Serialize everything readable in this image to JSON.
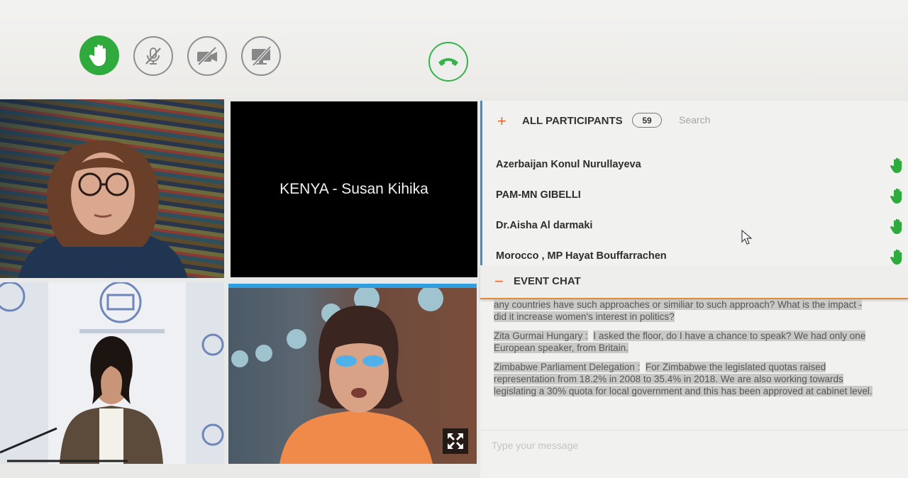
{
  "toolbar": {
    "icons": [
      "raise-hand-icon",
      "mic-muted-icon",
      "camera-off-icon",
      "screen-share-off-icon",
      "hang-up-icon"
    ],
    "colors": {
      "hand": "#2eab3c",
      "hangup": "#36b34a"
    }
  },
  "videos": {
    "kenya_label": "KENYA - Susan Kihika"
  },
  "participants": {
    "title": "ALL PARTICIPANTS",
    "count": "59",
    "search_placeholder": "Search",
    "items": [
      {
        "name": "Azerbaijan Konul Nurullayeva"
      },
      {
        "name": "PAM-MN GIBELLI"
      },
      {
        "name": "Dr.Aisha Al darmaki"
      },
      {
        "name": "Morocco , MP Hayat Bouffarrachen"
      }
    ]
  },
  "chat": {
    "title": "EVENT CHAT",
    "messages": [
      {
        "sender": "",
        "text": "any countries have such approaches or similiar to such approach? What is the impact - did it increase women's interest in politics?"
      },
      {
        "sender": "Zita Gurmai Hungary :",
        "text": "I asked the floor, do I have a chance to speak? We had only one European speaker, from Britain."
      },
      {
        "sender": "Zimbabwe Parliament Delegation :",
        "text": "For Zimbabwe the legislated quotas raised representation from 18.2% in 2008 to 35.4% in 2018. We are also working towards legislating a 30% quota for local government and this has been approved at cabinet level."
      }
    ],
    "input_placeholder": "Type your message"
  }
}
